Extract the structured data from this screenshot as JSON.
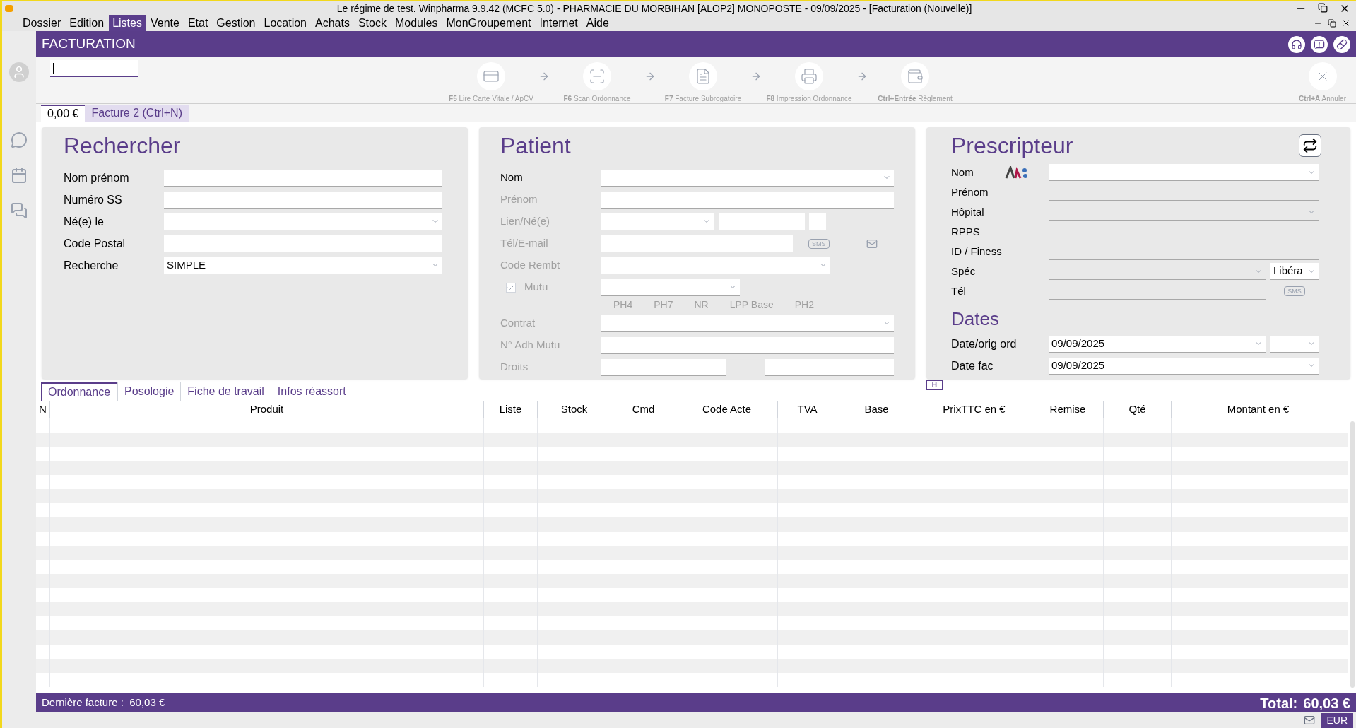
{
  "title_bar": {
    "title": "Le régime de test. Winpharma 9.9.42  (MCFC 5.0) - PHARMACIE DU MORBIHAN [ALOP2] MONOPOSTE - 09/09/2025 - [Facturation (Nouvelle)]"
  },
  "menu": [
    {
      "label": "Dossier",
      "selected": false
    },
    {
      "label": "Edition",
      "selected": false
    },
    {
      "label": "Listes",
      "selected": true
    },
    {
      "label": "Vente",
      "selected": false
    },
    {
      "label": "Etat",
      "selected": false
    },
    {
      "label": "Gestion",
      "selected": false
    },
    {
      "label": "Location",
      "selected": false
    },
    {
      "label": "Achats",
      "selected": false
    },
    {
      "label": "Stock",
      "selected": false
    },
    {
      "label": "Modules",
      "selected": false
    },
    {
      "label": "MonGroupement",
      "selected": false
    },
    {
      "label": "Internet",
      "selected": false
    },
    {
      "label": "Aide",
      "selected": false
    }
  ],
  "header": {
    "title": "FACTURATION"
  },
  "toolbar": {
    "steps": [
      {
        "key": "F5",
        "label": "Lire Carte Vitale / ApCV",
        "kind": "card"
      },
      {
        "key": "F6",
        "label": "Scan Ordonnance",
        "kind": "scan"
      },
      {
        "key": "F7",
        "label": "Facture Subrogatoire",
        "kind": "doc"
      },
      {
        "key": "F8",
        "label": "Impression Ordonnance",
        "kind": "print"
      },
      {
        "key": "Ctrl+Entrée",
        "label": "Règlement",
        "kind": "wallet"
      }
    ],
    "cancel": {
      "key": "Ctrl+A",
      "label": "Annuler"
    }
  },
  "invoice_tabs": [
    {
      "label": "0,00 €",
      "selected": true
    },
    {
      "label": "Facture 2 (Ctrl+N)",
      "selected": false
    }
  ],
  "search_panel": {
    "title": "Rechercher",
    "fields": [
      {
        "label": "Nom prénom",
        "kind": "text"
      },
      {
        "label": "Numéro SS",
        "kind": "text"
      },
      {
        "label": "Né(e) le",
        "kind": "select"
      },
      {
        "label": "Code Postal",
        "kind": "text"
      },
      {
        "label": "Recherche",
        "kind": "select",
        "value": "SIMPLE"
      }
    ]
  },
  "patient_panel": {
    "title": "Patient",
    "fields": [
      {
        "label": "Nom",
        "kind": "select",
        "disabled": false
      },
      {
        "label": "Prénom",
        "kind": "text",
        "disabled": true
      },
      {
        "label": "Lien/Né(e)",
        "kind": "lien",
        "disabled": true
      },
      {
        "label": "Tél/E-mail",
        "kind": "contact",
        "disabled": true,
        "sms": "SMS"
      },
      {
        "label": "Code Rembt",
        "kind": "select_short",
        "disabled": true
      },
      {
        "label": "Mutu",
        "kind": "check",
        "disabled": true,
        "checked": true
      },
      {
        "kind": "rates",
        "columns": [
          "PH4",
          "PH7",
          "NR",
          "LPP Base",
          "PH2"
        ]
      },
      {
        "label": "Contrat",
        "kind": "select",
        "disabled": true
      },
      {
        "label": "N° Adh Mutu",
        "kind": "text",
        "disabled": true
      },
      {
        "label": "Droits",
        "kind": "pair",
        "disabled": true
      }
    ]
  },
  "prescriber_panel": {
    "title": "Prescripteur",
    "fields": [
      {
        "label": "Nom",
        "kind": "select_logo"
      },
      {
        "label": "Prénom",
        "kind": "line"
      },
      {
        "label": "Hôpital",
        "kind": "line_select"
      },
      {
        "label": "RPPS",
        "kind": "line_pair"
      },
      {
        "label": "ID / Finess",
        "kind": "line"
      },
      {
        "label": "Spéc",
        "kind": "spec",
        "value": "Libéra"
      },
      {
        "label": "Tél",
        "kind": "tel",
        "sms": "SMS"
      }
    ],
    "dates_title": "Dates",
    "dates": [
      {
        "label": "Date/orig ord",
        "value": "09/09/2025",
        "kind": "double"
      },
      {
        "label": "Date fac",
        "value": "09/09/2025",
        "kind": "single"
      }
    ]
  },
  "h_button": "H",
  "detail_tabs": [
    {
      "label": "Ordonnance",
      "selected": true
    },
    {
      "label": "Posologie",
      "selected": false
    },
    {
      "label": "Fiche de travail",
      "selected": false
    },
    {
      "label": "Infos réassort",
      "selected": false
    }
  ],
  "table": {
    "columns": [
      "N",
      "Produit",
      "Liste",
      "Stock",
      "Cmd",
      "Code Acte",
      "TVA",
      "Base",
      "PrixTTC en €",
      "Remise",
      "Qté",
      "Montant en €"
    ]
  },
  "footer": {
    "last_invoice": "Dernière facture :  60,03 €",
    "total_label": "Total:",
    "total_value": "60,03 €"
  },
  "status_bar": {
    "currency": "EUR"
  }
}
